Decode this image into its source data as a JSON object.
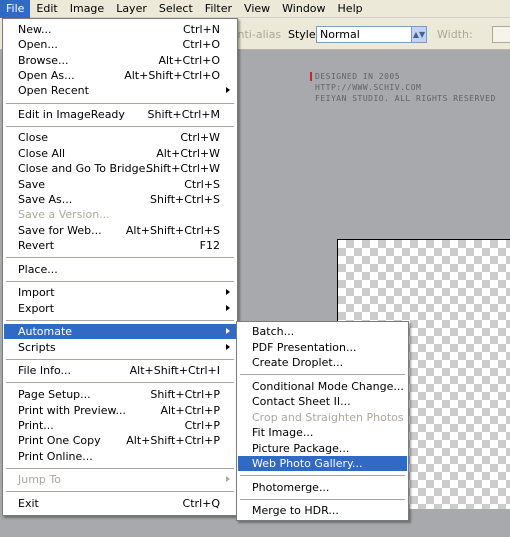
{
  "menubar": {
    "items": [
      {
        "label": "File"
      },
      {
        "label": "Edit"
      },
      {
        "label": "Image"
      },
      {
        "label": "Layer"
      },
      {
        "label": "Select"
      },
      {
        "label": "Filter"
      },
      {
        "label": "View"
      },
      {
        "label": "Window"
      },
      {
        "label": "Help"
      }
    ]
  },
  "options_bar": {
    "anti_alias_label": "Anti-alias",
    "style_label": "Style:",
    "style_value": "Normal",
    "width_label": "Width:"
  },
  "watermark": {
    "line1": "DESIGNED IN 2005 HTTP://WWW.SCHIV.COM",
    "line2": "FEIYAN STUDIO. ALL RIGHTS RESERVED"
  },
  "file_menu": {
    "items": [
      {
        "label": "New...",
        "shortcut": "Ctrl+N"
      },
      {
        "label": "Open...",
        "shortcut": "Ctrl+O"
      },
      {
        "label": "Browse...",
        "shortcut": "Alt+Ctrl+O"
      },
      {
        "label": "Open As...",
        "shortcut": "Alt+Shift+Ctrl+O"
      },
      {
        "label": "Open Recent",
        "shortcut": ""
      },
      {
        "label": "Edit in ImageReady",
        "shortcut": "Shift+Ctrl+M"
      },
      {
        "label": "Close",
        "shortcut": "Ctrl+W"
      },
      {
        "label": "Close All",
        "shortcut": "Alt+Ctrl+W"
      },
      {
        "label": "Close and Go To Bridge...",
        "shortcut": "Shift+Ctrl+W"
      },
      {
        "label": "Save",
        "shortcut": "Ctrl+S"
      },
      {
        "label": "Save As...",
        "shortcut": "Shift+Ctrl+S"
      },
      {
        "label": "Save a Version...",
        "shortcut": ""
      },
      {
        "label": "Save for Web...",
        "shortcut": "Alt+Shift+Ctrl+S"
      },
      {
        "label": "Revert",
        "shortcut": "F12"
      },
      {
        "label": "Place...",
        "shortcut": ""
      },
      {
        "label": "Import",
        "shortcut": ""
      },
      {
        "label": "Export",
        "shortcut": ""
      },
      {
        "label": "Automate",
        "shortcut": ""
      },
      {
        "label": "Scripts",
        "shortcut": ""
      },
      {
        "label": "File Info...",
        "shortcut": "Alt+Shift+Ctrl+I"
      },
      {
        "label": "Page Setup...",
        "shortcut": "Shift+Ctrl+P"
      },
      {
        "label": "Print with Preview...",
        "shortcut": "Alt+Ctrl+P"
      },
      {
        "label": "Print...",
        "shortcut": "Ctrl+P"
      },
      {
        "label": "Print One Copy",
        "shortcut": "Alt+Shift+Ctrl+P"
      },
      {
        "label": "Print Online...",
        "shortcut": ""
      },
      {
        "label": "Jump To",
        "shortcut": ""
      },
      {
        "label": "Exit",
        "shortcut": "Ctrl+Q"
      }
    ]
  },
  "automate_menu": {
    "items": [
      {
        "label": "Batch..."
      },
      {
        "label": "PDF Presentation..."
      },
      {
        "label": "Create Droplet..."
      },
      {
        "label": "Conditional Mode Change..."
      },
      {
        "label": "Contact Sheet II..."
      },
      {
        "label": "Crop and Straighten Photos"
      },
      {
        "label": "Fit Image..."
      },
      {
        "label": "Picture Package..."
      },
      {
        "label": "Web Photo Gallery..."
      },
      {
        "label": "Photomerge..."
      },
      {
        "label": "Merge to HDR..."
      }
    ]
  },
  "colors": {
    "highlight": "#316ac5",
    "menu_bg": "#ffffff",
    "disabled_text": "#aca899",
    "workspace": "#a7a9ac"
  },
  "icons": [
    "submenu-arrow-icon",
    "dropdown-arrow-icon"
  ]
}
